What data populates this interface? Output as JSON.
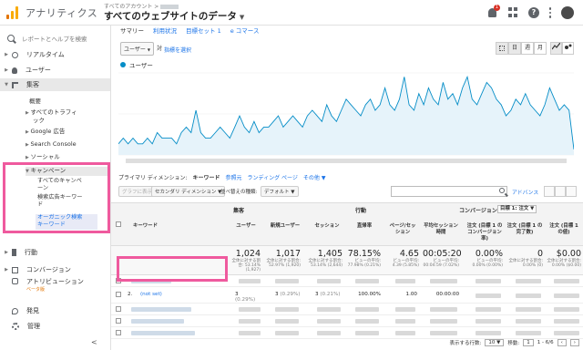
{
  "header": {
    "brand": "アナリティクス",
    "breadcrumb": "すべてのアカウント >",
    "view_title": "すべてのウェブサイトのデータ",
    "notification_count": "1",
    "help_label": "?"
  },
  "sidebar": {
    "search_placeholder": "レポートとヘルプを検索",
    "items": [
      {
        "label": "リアルタイム"
      },
      {
        "label": "ユーザー"
      },
      {
        "label": "集客"
      },
      {
        "label": "行動"
      },
      {
        "label": "コンバージョン"
      },
      {
        "label": "アトリビューション"
      },
      {
        "label": "発見"
      },
      {
        "label": "管理"
      }
    ],
    "acq_children": [
      "概要",
      "すべてのトラフィ",
      "ック",
      "Google 広告",
      "Search Console",
      "ソーシャル",
      "キャンペーン"
    ],
    "campaign_children": [
      "すべてのキャンペ",
      "ーン",
      "検索広告キーワー",
      "ド",
      "オーガニック検索",
      "キーワード"
    ],
    "beta": "ベータ版",
    "collapse": "<"
  },
  "tabs": [
    "サマリー",
    "利用状況",
    "目標セット 1",
    "e コマース"
  ],
  "toolbar": {
    "metric_select": "ユーザー",
    "vs": "対",
    "choose_metric": "指標を選択",
    "day": "日",
    "week": "週",
    "month": "月"
  },
  "chart_data": {
    "type": "line",
    "series": [
      {
        "name": "ユーザー",
        "values": [
          2,
          3,
          2,
          3,
          2,
          2,
          3,
          2,
          4,
          3,
          3,
          3,
          2,
          4,
          5,
          4,
          8,
          4,
          3,
          3,
          4,
          5,
          4,
          3,
          5,
          7,
          5,
          4,
          6,
          4,
          5,
          5,
          6,
          7,
          5,
          6,
          7,
          6,
          5,
          7,
          8,
          7,
          6,
          9,
          7,
          6,
          8,
          10,
          9,
          8,
          7,
          9,
          10,
          8,
          9,
          12,
          9,
          8,
          10,
          14,
          9,
          8,
          11,
          9,
          12,
          10,
          9,
          13,
          10,
          11,
          9,
          12,
          14,
          10,
          9,
          11,
          13,
          12,
          10,
          9,
          7,
          8,
          10,
          9,
          11,
          9,
          8,
          7,
          9,
          12,
          10,
          8,
          9,
          8,
          1
        ]
      }
    ],
    "color": "#058dc7"
  },
  "primary_dim": {
    "label": "プライマリ ディメンション:",
    "active": "キーワード",
    "others": [
      "参照元",
      "ランディング ページ",
      "その他"
    ]
  },
  "controls": {
    "plot_rows": "グラフに表示",
    "secondary": "セカンダリ ディメンション",
    "sort_type_label": "並べ替えの種類:",
    "sort_default": "デフォルト",
    "advanced": "アドバンス"
  },
  "table": {
    "groups": {
      "acq": "集客",
      "beh": "行動",
      "conv": "コンバージョン",
      "goal": "目標 1: 注文"
    },
    "col_keyword": "キーワード",
    "cols": [
      "ユーザー",
      "新規ユーザー",
      "セッション",
      "直帰率",
      "ページ/セッション",
      "平均セッション時間",
      "注文 (目標 1 のコンバージョン率)",
      "注文 (目標 1 の完了数)",
      "注文 (目標 1 の値)"
    ],
    "totals": [
      {
        "value": "1,024",
        "note": "全体に対する割合: 53.14% (1,927)"
      },
      {
        "value": "1,017",
        "note": "全体に対する割合: 52.97% (1,920)"
      },
      {
        "value": "1,405",
        "note": "全体に対する割合: 53.14% (2,644)"
      },
      {
        "value": "78.15%",
        "note": "ビューの平均: 77.98% (0.21%)"
      },
      {
        "value": "4.65",
        "note": "ビューの平均: 4.39 (5.85%)"
      },
      {
        "value": "00:05:20",
        "note": "ビューの平均: 00:04:59 (7.02%)"
      },
      {
        "value": "0.00%",
        "note": "ビューの平均: 0.00% (0.00%)"
      },
      {
        "value": "0",
        "note": "全体に対する割合: 0.00% (0)"
      },
      {
        "value": "$0.00",
        "note": "全体に対する割合: 0.00% ($0.00)"
      }
    ],
    "row2": {
      "index": "2.",
      "keyword": "(not set)",
      "users": "3",
      "users_pct": "(0.29%)",
      "new_users": "3",
      "new_users_pct": "(0.29%)",
      "sessions": "3",
      "sessions_pct": "(0.21%)",
      "bounce": "100.00%",
      "pages": "1.00",
      "duration": "00:00:00"
    }
  },
  "footer": {
    "rows_label": "表示する行数:",
    "rows_value": "10",
    "goto_label": "移動:",
    "goto_value": "1",
    "range": "1 - 6/6"
  }
}
